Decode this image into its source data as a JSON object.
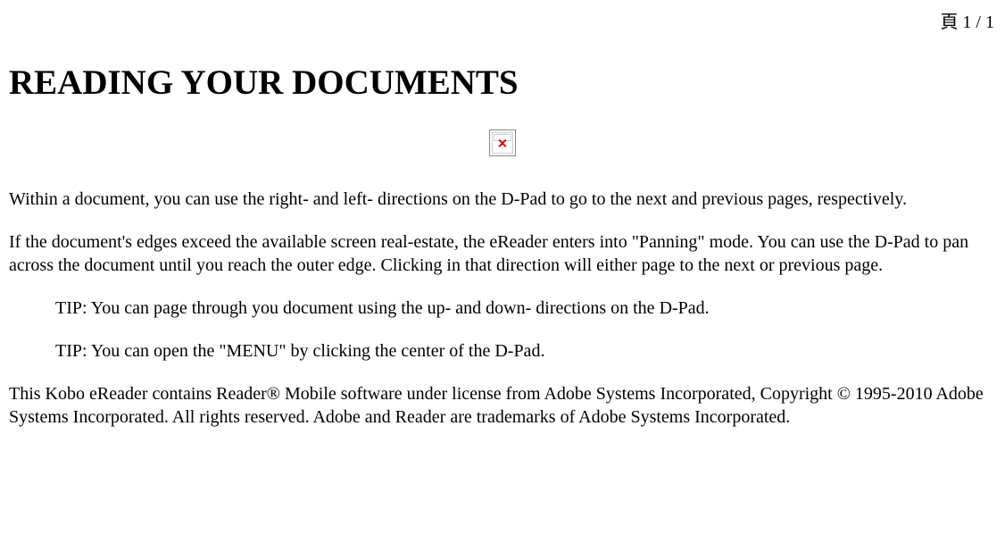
{
  "page_indicator": "頁 1 / 1",
  "title": "READING YOUR DOCUMENTS",
  "broken_image_alt": "broken-image-icon",
  "paragraph1": "Within a document, you can use the right- and left- directions on the D-Pad to go to the next and previous pages, respectively.",
  "paragraph2": "If the document's edges exceed the available screen real-estate, the eReader enters into \"Panning\" mode. You can use the D-Pad to pan across the document until you reach the outer edge. Clicking in that direction will either page to the next or previous page.",
  "tip1": "TIP: You can page through you document using the up- and down- directions on the D-Pad.",
  "tip2": "TIP: You can open the \"MENU\" by clicking the center of the D-Pad.",
  "paragraph3": "This Kobo eReader contains Reader® Mobile software under license from Adobe Systems Incorporated, Copyright © 1995-2010 Adobe Systems Incorporated. All rights reserved. Adobe and Reader are trademarks of Adobe Systems Incorporated."
}
